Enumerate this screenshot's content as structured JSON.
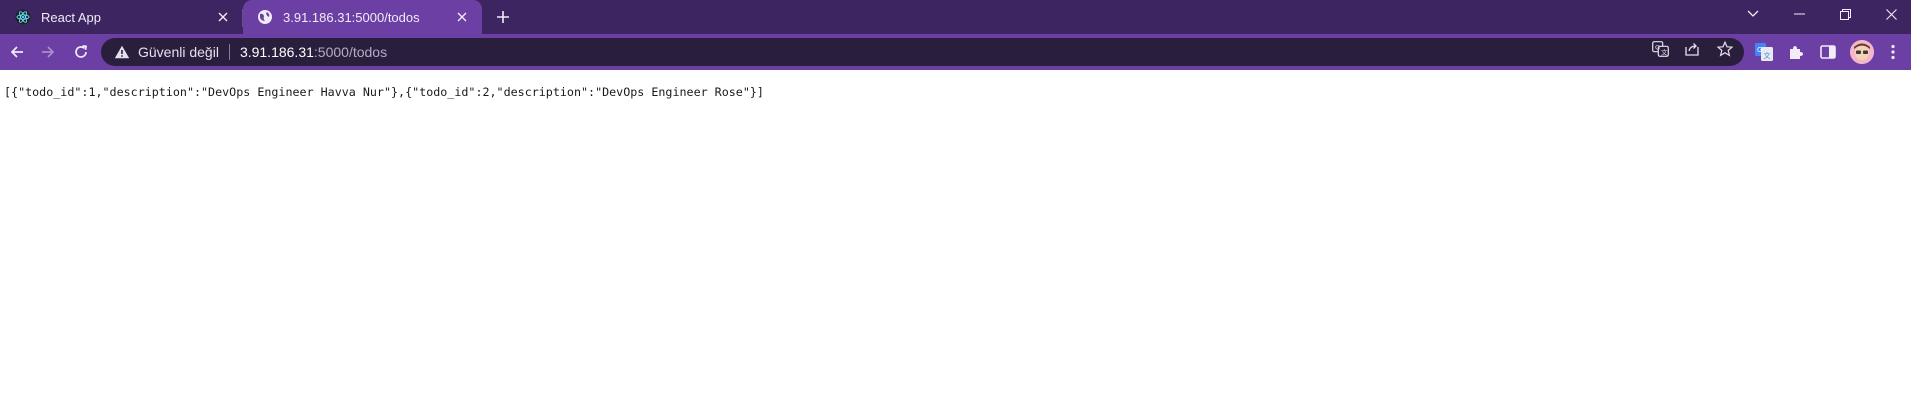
{
  "browser": {
    "tabs": [
      {
        "title": "React App",
        "favicon": "react-icon",
        "active": false
      },
      {
        "title": "3.91.186.31:5000/todos",
        "favicon": "globe-icon",
        "active": true
      }
    ],
    "new_tab_icon": "plus-icon",
    "window_controls": [
      "chevron-down-icon",
      "minimize-icon",
      "restore-icon",
      "close-icon"
    ]
  },
  "toolbar": {
    "security_label": "Güvenli değil",
    "url_host": "3.91.186.31",
    "url_path": ":5000/todos",
    "omnibox_icons": [
      "translate-icon",
      "share-icon",
      "star-icon"
    ],
    "extension_icons": [
      "google-translate-icon",
      "puzzle-icon",
      "side-panel-icon",
      "avatar",
      "menu-icon"
    ]
  },
  "page": {
    "body_text": "[{\"todo_id\":1,\"description\":\"DevOps Engineer Havva Nur\"},{\"todo_id\":2,\"description\":\"DevOps Engineer Rose\"}]"
  },
  "colors": {
    "tabstrip": "#3d2561",
    "active_tab": "#6b3fa3",
    "omnibox": "#2a1e3d",
    "page_bg": "#ffffff"
  }
}
